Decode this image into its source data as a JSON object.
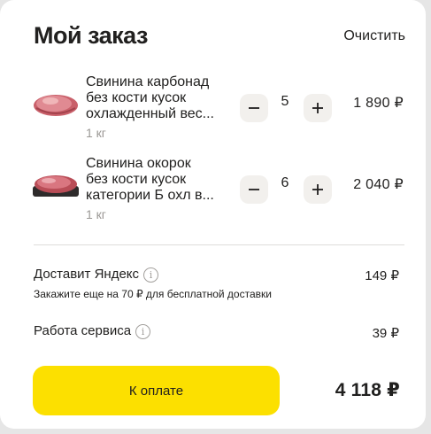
{
  "header": {
    "title": "Мой заказ",
    "clear_label": "Очистить"
  },
  "items": [
    {
      "name_lines": [
        "Свинина карбонад",
        "без кости кусок",
        "охлажденный вес..."
      ],
      "weight": "1 кг",
      "quantity": "5",
      "price": "1 890 ₽",
      "image_icon": "pork-loin-icon"
    },
    {
      "name_lines": [
        "Свинина окорок",
        "без кости кусок",
        "категории Б охл в..."
      ],
      "weight": "1 кг",
      "quantity": "6",
      "price": "2 040 ₽",
      "image_icon": "pork-ham-tray-icon"
    }
  ],
  "delivery": {
    "label": "Доставит Яндекс",
    "value": "149 ₽",
    "note": "Закажите еще на 70 ₽ для бесплатной доставки"
  },
  "service": {
    "label": "Работа сервиса",
    "value": "39 ₽"
  },
  "footer": {
    "pay_label": "К оплате",
    "total": "4 118 ₽"
  },
  "colors": {
    "accent": "#fce000",
    "stepper_bg": "#f2f0ed",
    "muted_text": "#9b9895"
  }
}
